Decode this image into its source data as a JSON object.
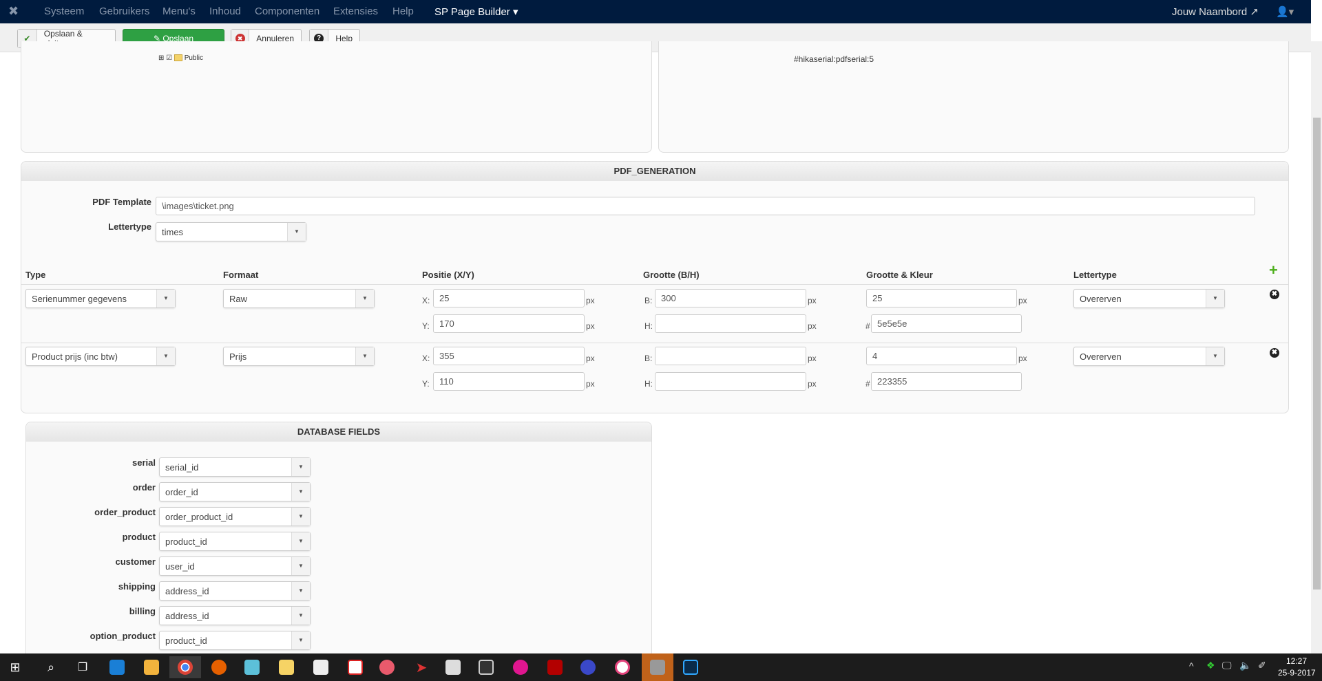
{
  "nav": {
    "items": [
      "Systeem",
      "Gebruikers",
      "Menu's",
      "Inhoud",
      "Componenten",
      "Extensies",
      "Help"
    ],
    "active": "SP Page Builder",
    "site": "Jouw Naambord"
  },
  "toolbar": {
    "save_close": "Opslaan & sluiten",
    "save": "Opslaan",
    "cancel": "Annuleren",
    "help": "Help"
  },
  "top_panels": {
    "tree_item": "Public",
    "tag": "#hikaserial:pdfserial:5"
  },
  "pdf": {
    "title": "PDF_GENERATION",
    "template_label": "PDF Template",
    "template_value": "\\images\\ticket.png",
    "font_label": "Lettertype",
    "font_value": "times",
    "columns": [
      "Type",
      "Formaat",
      "Positie (X/Y)",
      "Grootte (B/H)",
      "Grootte & Kleur",
      "Lettertype"
    ],
    "labels": {
      "x": "X:",
      "y": "Y:",
      "b": "B:",
      "h": "H:",
      "px": "px",
      "hash": "#"
    },
    "rows": [
      {
        "type": "Serienummer gegevens",
        "format": "Raw",
        "x": "25",
        "y": "170",
        "b": "300",
        "h": "",
        "size": "25",
        "color": "5e5e5e",
        "font": "Overerven"
      },
      {
        "type": "Product prijs (inc btw)",
        "format": "Prijs",
        "x": "355",
        "y": "110",
        "b": "",
        "h": "",
        "size": "4",
        "color": "223355",
        "font": "Overerven"
      }
    ]
  },
  "db": {
    "title": "DATABASE FIELDS",
    "fields": [
      {
        "label": "serial",
        "value": "serial_id"
      },
      {
        "label": "order",
        "value": "order_id"
      },
      {
        "label": "order_product",
        "value": "order_product_id"
      },
      {
        "label": "product",
        "value": "product_id"
      },
      {
        "label": "customer",
        "value": "user_id"
      },
      {
        "label": "shipping",
        "value": "address_id"
      },
      {
        "label": "billing",
        "value": "address_id"
      },
      {
        "label": "option_product",
        "value": "product_id"
      }
    ]
  },
  "taskbar": {
    "time": "12:27",
    "date": "25-9-2017"
  },
  "colors": {
    "nav": "#001b3e",
    "save": "#2ea043",
    "accent": "#4caf1a"
  }
}
